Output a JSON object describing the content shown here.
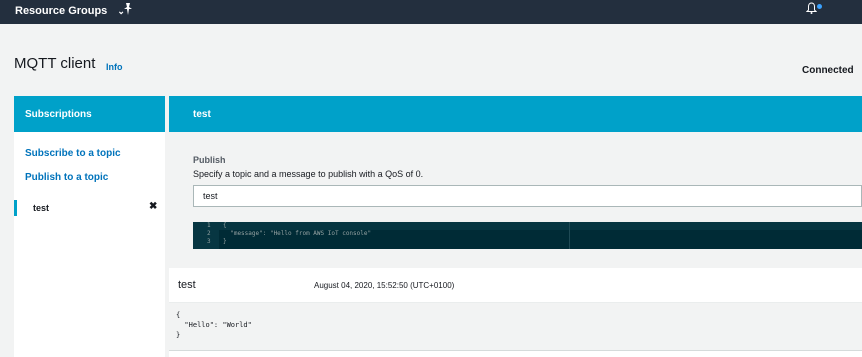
{
  "topbar": {
    "resource_groups_label": "Resource Groups",
    "chevron": "⌄",
    "pin_icon": "pin-icon",
    "bell_icon": "bell-icon"
  },
  "header": {
    "title": "MQTT client",
    "info": "Info",
    "status": "Connected"
  },
  "sidebar": {
    "title": "Subscriptions",
    "links": [
      "Subscribe to a topic",
      "Publish to a topic"
    ],
    "subscriptions": [
      {
        "name": "test",
        "remove": "✖"
      }
    ]
  },
  "main": {
    "topic_title": "test",
    "publish": {
      "label": "Publish",
      "description": "Specify a topic and a message to publish with a QoS of 0.",
      "topic_value": "test",
      "editor_lines": [
        {
          "num": "1",
          "text": "{"
        },
        {
          "num": "2",
          "text": "  \"message\": \"Hello from AWS IoT console\""
        },
        {
          "num": "3",
          "text": "}"
        }
      ]
    },
    "message": {
      "topic": "test",
      "timestamp": "August 04, 2020, 15:52:50 (UTC+0100)",
      "payload_lines": [
        "{",
        "  \"Hello\": \"World\"",
        "}"
      ]
    }
  },
  "colors": {
    "topbar": "#232f3e",
    "accent": "#00a1c9",
    "link": "#0073bb",
    "editor_bg": "#002b36"
  }
}
